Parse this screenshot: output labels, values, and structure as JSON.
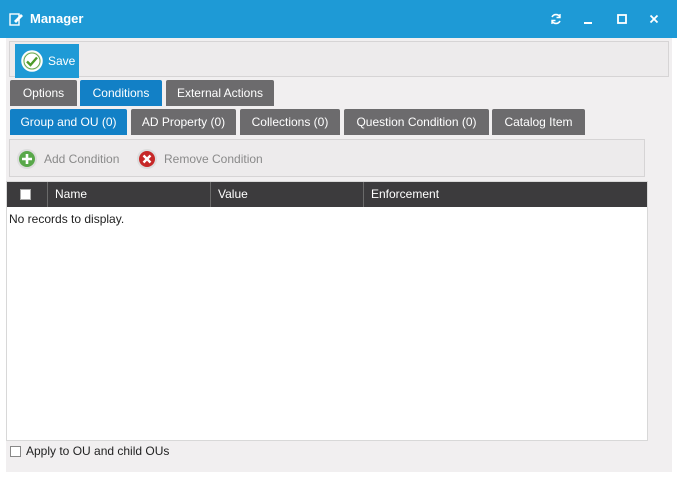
{
  "window": {
    "title": "Manager"
  },
  "toolbar": {
    "save_label": "Save"
  },
  "tabs_main": [
    {
      "label": "Options",
      "active": false
    },
    {
      "label": "Conditions",
      "active": true
    },
    {
      "label": "External Actions",
      "active": false
    }
  ],
  "tabs_sub": [
    {
      "label": "Group and OU (0)",
      "active": true
    },
    {
      "label": "AD Property (0)",
      "active": false
    },
    {
      "label": "Collections (0)",
      "active": false
    },
    {
      "label": "Question Condition (0)",
      "active": false
    },
    {
      "label": "Catalog Item",
      "active": false
    }
  ],
  "condition_toolbar": {
    "add_label": "Add Condition",
    "remove_label": "Remove Condition"
  },
  "grid": {
    "columns": [
      "Name",
      "Value",
      "Enforcement"
    ],
    "empty_message": "No records to display."
  },
  "footer": {
    "apply_label": "Apply to OU and child OUs",
    "apply_checked": false
  },
  "colors": {
    "accent": "#1e9ad6",
    "active_tab": "#1280c6",
    "inactive_tab": "#6c6b6d",
    "grid_header": "#3c3b3d"
  }
}
